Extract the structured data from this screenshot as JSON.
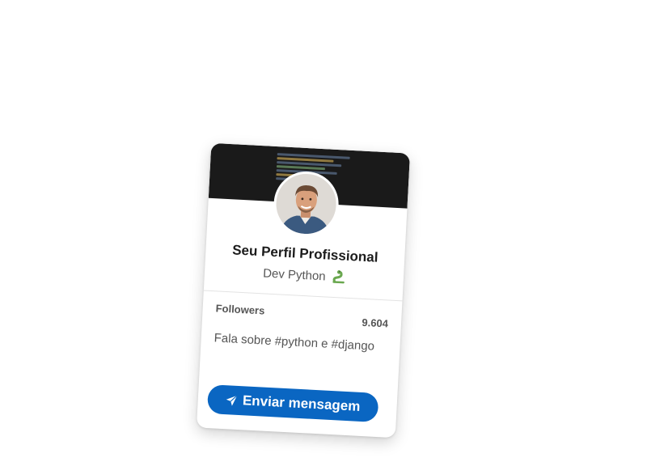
{
  "profile": {
    "name": "Seu Perfil Profissional",
    "role": "Dev Python",
    "role_emoji_icon": "snake-icon",
    "avatar_icon": "avatar-photo"
  },
  "stats": {
    "label": "Followers",
    "value": "9.604"
  },
  "bio": "Fala sobre #python e #django",
  "action": {
    "label": "Enviar mensagem",
    "icon": "send-icon"
  },
  "colors": {
    "accent": "#0a66c2",
    "banner": "#1a1a1a"
  }
}
